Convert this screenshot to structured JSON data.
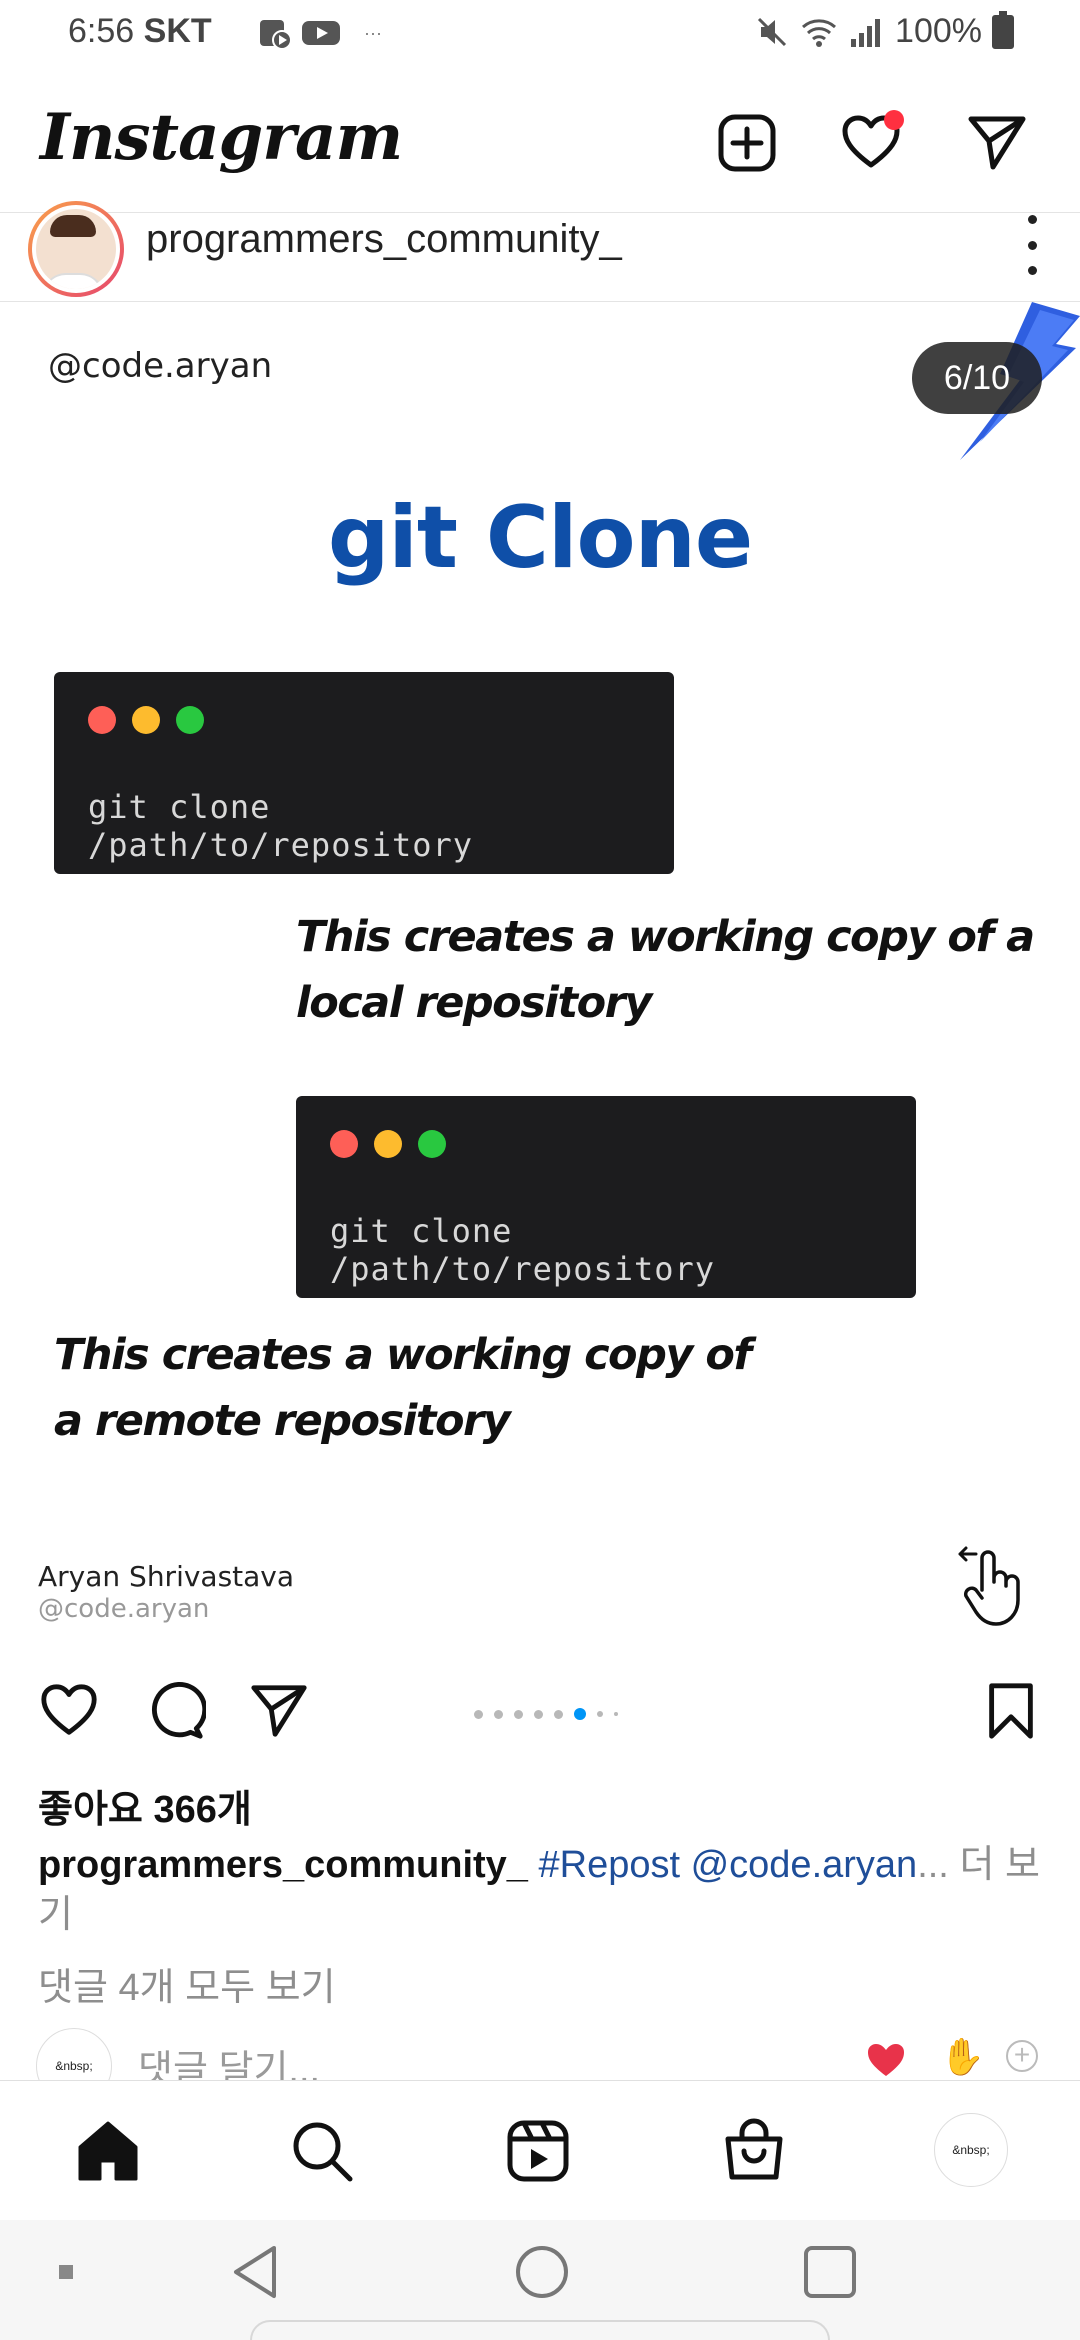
{
  "status_bar": {
    "time": "6:56",
    "carrier": "SKT",
    "overflow": "···",
    "battery": "100%",
    "icons": [
      "youtube-music-icon",
      "youtube-icon",
      "mute-icon",
      "wifi-icon",
      "signal-icon",
      "battery-icon"
    ]
  },
  "header": {
    "logo": "Instagram",
    "notification_dot_color": "#ff3040"
  },
  "post": {
    "author": "programmers_community_",
    "slide": {
      "handle": "@code.aryan",
      "counter": "6/10",
      "title": "git Clone",
      "code_1": "git clone /path/to/repository",
      "desc_1_line1": "This creates a working copy of a",
      "desc_1_line2": "local repository",
      "code_2": "git clone /path/to/repository",
      "desc_2_line1": "This creates a working copy of",
      "desc_2_line2": "a remote repository",
      "credit_name": "Aryan Shrivastava",
      "credit_handle": "@code.aryan"
    },
    "pager": {
      "current": 6,
      "total": 10,
      "active_color": "#0095f6"
    },
    "likes": "좋아요 366개",
    "caption": {
      "user": "programmers_community_",
      "text": "#Repost @code.aryan",
      "ellipsis": "...",
      "more": "더 보기"
    },
    "comments_link": "댓글 4개 모두 보기",
    "comment_input": {
      "avatar_alt": "&nbsp;",
      "placeholder": "댓글 달기..."
    }
  },
  "bottom_nav": {
    "profile_alt": "&nbsp;",
    "items": [
      "home-icon",
      "search-icon",
      "reels-icon",
      "shop-icon",
      "profile-avatar"
    ]
  },
  "colors": {
    "title_blue": "#0f4fa8",
    "code_bg": "#1c1c1e",
    "hashtag": "#1f4e99"
  }
}
